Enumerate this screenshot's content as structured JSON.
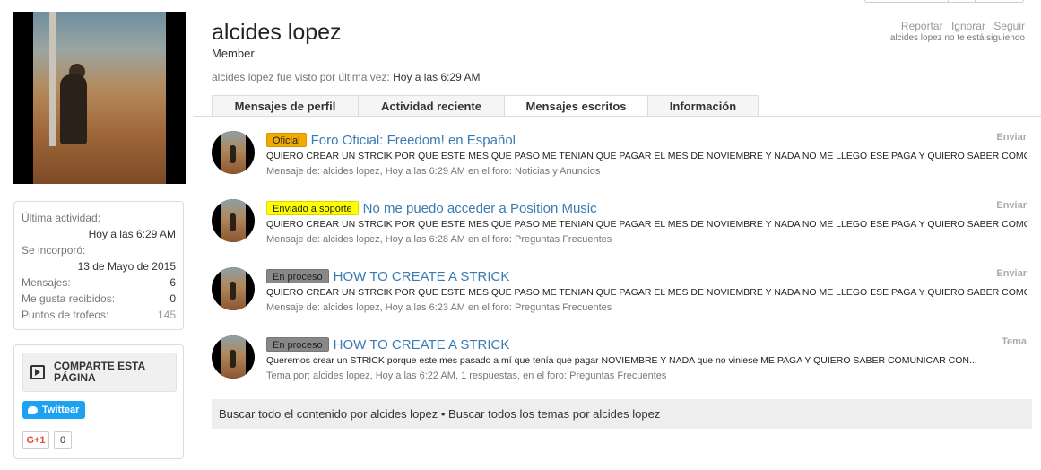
{
  "profile": {
    "name": "alcides lopez",
    "title": "Member",
    "last_seen_prefix": "alcides lopez fue visto por última vez:",
    "last_seen_value": "Hoy a las 6:29 AM",
    "actions": [
      "Reportar",
      "Ignorar",
      "Seguir"
    ],
    "follow_note": "alcides lopez no te está siguiendo"
  },
  "stats": {
    "last_activity_label": "Última actividad:",
    "last_activity_value": "Hoy a las 6:29 AM",
    "joined_label": "Se incorporó:",
    "joined_value": "13 de Mayo de 2015",
    "rows": [
      {
        "label": "Mensajes:",
        "value": "6"
      },
      {
        "label": "Me gusta recibidos:",
        "value": "0"
      },
      {
        "label": "Puntos de trofeos:",
        "value": "145"
      }
    ]
  },
  "share": {
    "title_line1": "COMPARTE ESTA",
    "title_line2": "PÁGINA",
    "tweet_label": "Twittear",
    "gplus_label": "G+1",
    "gplus_count": "0"
  },
  "tabs": [
    "Mensajes de perfil",
    "Actividad reciente",
    "Mensajes escritos",
    "Información"
  ],
  "active_tab": "Mensajes escritos",
  "posts": [
    {
      "prefix": "Oficial",
      "title": "Foro Oficial: Freedom! en Español",
      "snippet": "QUIERO CREAR UN STRCIK POR QUE ESTE MES QUE PASO ME TENIAN QUE PAGAR EL MES DE NOVIEMBRE Y NADA NO ME LLEGO ESE PAGA Y QUIERO SABER COMO...",
      "meta_prefix": "Mensaje de:",
      "author": "alcides lopez",
      "meta_time": ", Hoy a las 6:29 AM en el foro:",
      "forum": "Noticias y Anuncios",
      "right_label": "Enviar"
    },
    {
      "prefix": "Enviado a soporte",
      "title": "No me puedo acceder a Position Music",
      "snippet": "QUIERO CREAR UN STRCIK POR QUE ESTE MES QUE PASO ME TENIAN QUE PAGAR EL MES DE NOVIEMBRE Y NADA NO ME LLEGO ESE PAGA Y QUIERO SABER COMO...",
      "meta_prefix": "Mensaje de:",
      "author": "alcides lopez",
      "meta_time": ", Hoy a las 6:28 AM en el foro:",
      "forum": "Preguntas Frecuentes",
      "right_label": "Enviar"
    },
    {
      "prefix": "En proceso",
      "title": "HOW TO CREATE A STRICK",
      "snippet": "QUIERO CREAR UN STRCIK POR QUE ESTE MES QUE PASO ME TENIAN QUE PAGAR EL MES DE NOVIEMBRE Y NADA NO ME LLEGO ESE PAGA Y QUIERO SABER COMO...",
      "meta_prefix": "Mensaje de:",
      "author": "alcides lopez",
      "meta_time": ", Hoy a las 6:23 AM en el foro:",
      "forum": "Preguntas Frecuentes",
      "right_label": "Enviar"
    },
    {
      "prefix": "En proceso",
      "title": "HOW TO CREATE A STRICK",
      "snippet": "Queremos crear un STRICK porque este mes pasado a mí que tenía que pagar NOVIEMBRE Y NADA que no viniese ME PAGA Y QUIERO SABER COMUNICAR CON...",
      "meta_prefix": "Tema por:",
      "author": "alcides lopez",
      "meta_time": ", Hoy a las 6:22 AM, 1 respuestas, en el foro:",
      "forum": "Preguntas Frecuentes",
      "right_label": "Tema"
    }
  ],
  "footer": {
    "search_content": "Buscar todo el contenido por alcides lopez",
    "separator": " • ",
    "search_threads": "Buscar todos los temas por alcides lopez"
  }
}
